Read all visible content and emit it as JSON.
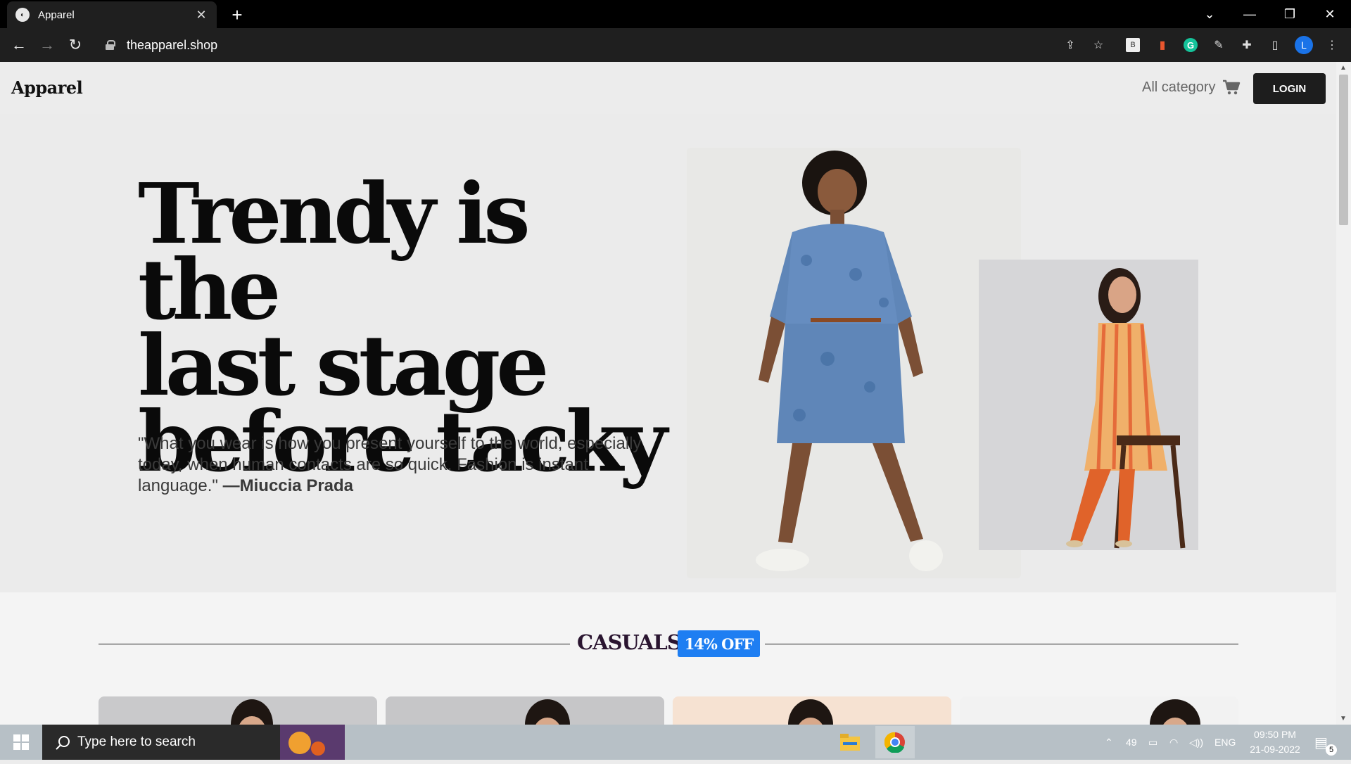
{
  "browser": {
    "tab_title": "Apparel",
    "url": "theapparel.shop",
    "profile_initial": "L"
  },
  "site": {
    "logo": "Apparel",
    "nav_category": "All category",
    "login_label": "LOGIN"
  },
  "hero": {
    "headline_lines": [
      "Trendy is the",
      "last stage",
      "before tacky"
    ],
    "quote_text": "\"What you wear is how you present yourself to the world, especially today, when human contacts are so quick. Fashion is instant language.\" ",
    "quote_author": "—Miuccia Prada"
  },
  "section": {
    "title": "CASUALS",
    "badge": "14% OFF"
  },
  "taskbar": {
    "search_placeholder": "Type here to search",
    "tray_number": "49",
    "language": "ENG",
    "time": "09:50 PM",
    "date": "21-09-2022",
    "notification_count": "5"
  },
  "colors": {
    "accent_badge": "#1e7ef2",
    "login_bg": "#1d1d1d"
  }
}
